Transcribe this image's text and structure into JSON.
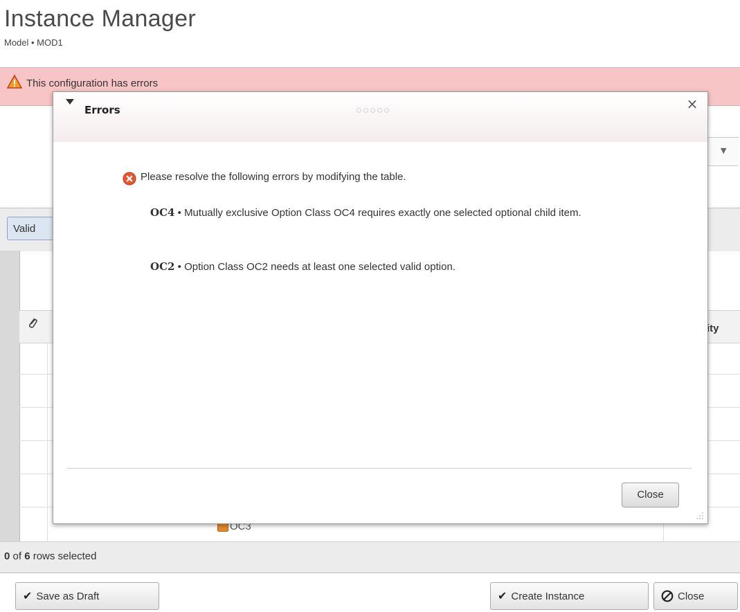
{
  "header": {
    "title": "Instance Manager",
    "subtitle": "Model • MOD1"
  },
  "banner": {
    "text": "This configuration has errors",
    "icon": "warning-triangle-icon",
    "color": "#f7c5c5"
  },
  "toolbar": {
    "validate_label": "Valid"
  },
  "table": {
    "header_partial": "tity",
    "visible_row_label": "OC3"
  },
  "status": {
    "selected": "0",
    "of": "of",
    "total": "6",
    "suffix": "rows selected"
  },
  "footer": {
    "save_draft_label": "Save as Draft",
    "create_instance_label": "Create Instance",
    "close_label": "Close"
  },
  "modal": {
    "title": "Errors",
    "header_message": "Please resolve the following errors by modifying the table.",
    "errors": [
      {
        "code": "OC4",
        "separator": "•",
        "message": "Mutually exclusive Option Class OC4 requires exactly one selected optional child item."
      },
      {
        "code": "OC2",
        "separator": "•",
        "message": "Option Class OC2 needs at least one selected valid option."
      }
    ],
    "close_label": "Close",
    "close_x": "×"
  }
}
